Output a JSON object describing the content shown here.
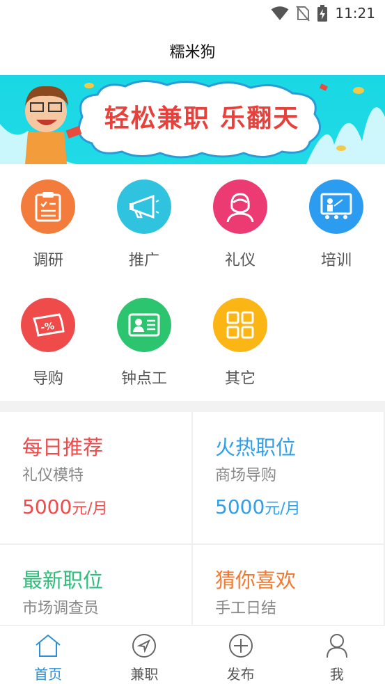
{
  "status_bar": {
    "time": "11:21"
  },
  "header": {
    "title": "糯米狗"
  },
  "banner": {
    "text": "轻松兼职 乐翻天"
  },
  "categories": [
    {
      "label": "调研",
      "color": "#f37c3d",
      "icon": "clipboard-icon"
    },
    {
      "label": "推广",
      "color": "#2fc3e0",
      "icon": "megaphone-icon"
    },
    {
      "label": "礼仪",
      "color": "#ec3b73",
      "icon": "hostess-icon"
    },
    {
      "label": "培训",
      "color": "#2b9cf0",
      "icon": "presentation-icon"
    },
    {
      "label": "导购",
      "color": "#f04b4b",
      "icon": "coupon-icon"
    },
    {
      "label": "钟点工",
      "color": "#2cc46f",
      "icon": "id-card-icon"
    },
    {
      "label": "其它",
      "color": "#fbb514",
      "icon": "grid-icon"
    }
  ],
  "cards": [
    {
      "title": "每日推荐",
      "subtitle": "礼仪模特",
      "salary": "5000",
      "unit": "元/月",
      "color": "#f04a4a"
    },
    {
      "title": "火热职位",
      "subtitle": "商场导购",
      "salary": "5000",
      "unit": "元/月",
      "color": "#2f9fe8"
    },
    {
      "title": "最新职位",
      "subtitle": "市场调查员",
      "salary": "",
      "unit": "",
      "color": "#2dbf7a"
    },
    {
      "title": "猜你喜欢",
      "subtitle": "手工日结",
      "salary": "",
      "unit": "",
      "color": "#f07a32"
    }
  ],
  "bottom_nav": [
    {
      "label": "首页",
      "icon": "home-icon",
      "active": true
    },
    {
      "label": "兼职",
      "icon": "compass-icon",
      "active": false
    },
    {
      "label": "发布",
      "icon": "add-circle-icon",
      "active": false
    },
    {
      "label": "我",
      "icon": "user-icon",
      "active": false
    }
  ],
  "colors": {
    "accent": "#2d8fd5",
    "banner_bg": "#1cd8e5"
  }
}
